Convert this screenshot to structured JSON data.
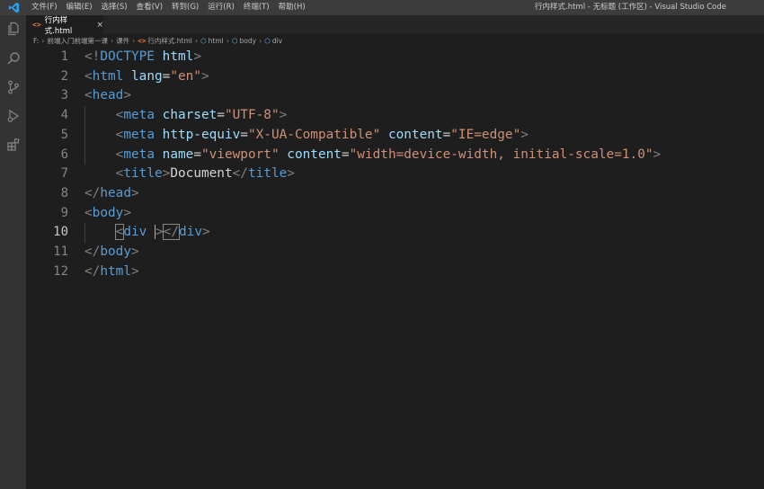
{
  "titlebar": {
    "logo_icon": "vscode-logo-icon",
    "menu": [
      "文件(F)",
      "编辑(E)",
      "选择(S)",
      "查看(V)",
      "转到(G)",
      "运行(R)",
      "终端(T)",
      "帮助(H)"
    ],
    "window_title": "行内样式.html - 无标题 (工作区) - Visual Studio Code"
  },
  "activitybar": {
    "icons": [
      "explorer-icon",
      "search-icon",
      "source-control-icon",
      "run-debug-icon",
      "extensions-icon"
    ]
  },
  "tabs": [
    {
      "icon": "html-file-icon",
      "label": "行内样式.html",
      "close": "×"
    }
  ],
  "breadcrumb": {
    "items": [
      "F:",
      "前端入门前端第一课",
      "课件",
      "行内样式.html",
      "html",
      "body",
      "div"
    ],
    "separator": "›"
  },
  "editor": {
    "active_line": 10,
    "lines": [
      {
        "n": "1",
        "tokens": [
          [
            "punc",
            "<!"
          ],
          [
            "tag",
            "DOCTYPE"
          ],
          [
            "text",
            " "
          ],
          [
            "attr",
            "html"
          ],
          [
            "punc",
            ">"
          ]
        ]
      },
      {
        "n": "2",
        "tokens": [
          [
            "punc",
            "<"
          ],
          [
            "tag",
            "html"
          ],
          [
            "text",
            " "
          ],
          [
            "attr",
            "lang"
          ],
          [
            "text",
            "="
          ],
          [
            "str",
            "\"en\""
          ],
          [
            "punc",
            ">"
          ]
        ]
      },
      {
        "n": "3",
        "tokens": [
          [
            "punc",
            "<"
          ],
          [
            "tag",
            "head"
          ],
          [
            "punc",
            ">"
          ]
        ]
      },
      {
        "n": "4",
        "tokens": [
          [
            "text",
            "    "
          ],
          [
            "punc",
            "<"
          ],
          [
            "tag",
            "meta"
          ],
          [
            "text",
            " "
          ],
          [
            "attr",
            "charset"
          ],
          [
            "text",
            "="
          ],
          [
            "str",
            "\"UTF-8\""
          ],
          [
            "punc",
            ">"
          ]
        ]
      },
      {
        "n": "5",
        "tokens": [
          [
            "text",
            "    "
          ],
          [
            "punc",
            "<"
          ],
          [
            "tag",
            "meta"
          ],
          [
            "text",
            " "
          ],
          [
            "attr",
            "http-equiv"
          ],
          [
            "text",
            "="
          ],
          [
            "str",
            "\"X-UA-Compatible\""
          ],
          [
            "text",
            " "
          ],
          [
            "attr",
            "content"
          ],
          [
            "text",
            "="
          ],
          [
            "str",
            "\"IE=edge\""
          ],
          [
            "punc",
            ">"
          ]
        ]
      },
      {
        "n": "6",
        "tokens": [
          [
            "text",
            "    "
          ],
          [
            "punc",
            "<"
          ],
          [
            "tag",
            "meta"
          ],
          [
            "text",
            " "
          ],
          [
            "attr",
            "name"
          ],
          [
            "text",
            "="
          ],
          [
            "str",
            "\"viewport\""
          ],
          [
            "text",
            " "
          ],
          [
            "attr",
            "content"
          ],
          [
            "text",
            "="
          ],
          [
            "str",
            "\"width=device-width, initial-scale=1.0\""
          ],
          [
            "punc",
            ">"
          ]
        ]
      },
      {
        "n": "7",
        "tokens": [
          [
            "text",
            "    "
          ],
          [
            "punc",
            "<"
          ],
          [
            "tag",
            "title"
          ],
          [
            "punc",
            ">"
          ],
          [
            "text",
            "Document"
          ],
          [
            "punc",
            "</"
          ],
          [
            "tag",
            "title"
          ],
          [
            "punc",
            ">"
          ]
        ]
      },
      {
        "n": "8",
        "tokens": [
          [
            "punc",
            "</"
          ],
          [
            "tag",
            "head"
          ],
          [
            "punc",
            ">"
          ]
        ]
      },
      {
        "n": "9",
        "tokens": [
          [
            "punc",
            "<"
          ],
          [
            "tag",
            "body"
          ],
          [
            "punc",
            ">"
          ]
        ]
      },
      {
        "n": "10",
        "tokens": [
          [
            "text",
            "    "
          ],
          [
            "punc",
            "<"
          ],
          [
            "tag",
            "div"
          ],
          [
            "text",
            " "
          ],
          [
            "cursor",
            ""
          ],
          [
            "punc",
            ">"
          ],
          [
            "punc",
            "</"
          ],
          [
            "tag",
            "div"
          ],
          [
            "punc",
            ">"
          ]
        ]
      },
      {
        "n": "11",
        "tokens": [
          [
            "punc",
            "</"
          ],
          [
            "tag",
            "body"
          ],
          [
            "punc",
            ">"
          ]
        ]
      },
      {
        "n": "12",
        "tokens": [
          [
            "punc",
            "</"
          ],
          [
            "tag",
            "html"
          ],
          [
            "punc",
            ">"
          ]
        ]
      }
    ]
  },
  "colors": {
    "background": "#1e1e1e",
    "titlebar": "#3c3c3c",
    "activitybar": "#333333",
    "tag": "#569cd6",
    "attribute": "#9cdcfe",
    "string": "#ce9178",
    "punctuation": "#808080"
  }
}
